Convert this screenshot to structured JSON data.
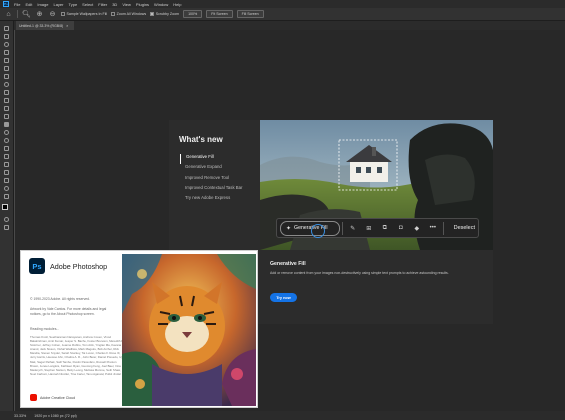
{
  "menubar": {
    "app_badge": "Ps",
    "items": [
      "File",
      "Edit",
      "Image",
      "Layer",
      "Type",
      "Select",
      "Filter",
      "3D",
      "View",
      "Plugins",
      "Window",
      "Help"
    ]
  },
  "options_bar": {
    "sample_all_layers": "Sample Wallpapers In Fill",
    "scrubby_zoom": "Scrubby Zoom",
    "zoom_value": "100%",
    "fit_screen": "Fit Screen",
    "fill_screen": "Fill Screen"
  },
  "document_tab": {
    "label": "Untitled-1 @ 33.3% (RGB/8)",
    "close_glyph": "×"
  },
  "status_bar": {
    "zoom": "33.33%",
    "doc_info": "1920 px x 1080 px (72 ppi)"
  },
  "whats_new": {
    "title": "What's new",
    "items": [
      "Generative Fill",
      "Generative Expand",
      "Improved Remove Tool",
      "Improved Contextual Task Bar",
      "Try new Adobe Express"
    ],
    "active_index": 0,
    "taskbar": {
      "generative_fill_label": "Generative Fill",
      "deselect_label": "Deselect",
      "icons": [
        "brush-icon",
        "transform-icon",
        "crop-icon",
        "mask-icon",
        "fill-icon",
        "more-icon"
      ]
    },
    "feature_title": "Generative Fill",
    "feature_description": "Add or remove content from your images non-destructively using simple text prompts to achieve astounding results.",
    "cta_label": "Try now"
  },
  "splash": {
    "logo": "Ps",
    "product_name": "Adobe Photoshop",
    "copyright": "© 1990-2023 Adobe. All rights reserved.",
    "credit": "Artwork by Vale Cantos. For more details and legal notices, go to the About Photoshop screen.",
    "starting": "Reading modules...",
    "names": "Thomas Knoll, Seetharaman Narayanan, Andrew Coven, Vinod Balakrishnan, Amit Kumar, Jesper S. Bache, Foster Brereton, Meredith P. Stotzner, Jeffrey Cohen, Jeanne Rubbo, Tom Attix, Yinglan Ma, Kavana Anand, Jack Sisson, Vishal Wadhwa, Mark Maguire, Bob Archer, Rick Mandia, Steven Snyder, Sarah Stuckey, Tai Luxon, Charles F. Rose III, Jerry Harris, Heewoo Ahn, Chaitra A. R., John Beier, Daniel Presedo, Ivy Mak, Sagar Pathak, Salil Tambe, Dustin Passofaro, Russell Preston Brown, Jenée Langlois, Kathleen Ryan, Guotong Feng, Joel Baer, Irina Maderych, Stephen Nielson, Betty Leong, Melissa Monroe, Seth Shaw, Noel Carboni, Hannah Nicollet, Tina Carter, Tanu Agarwal, Pulkit Jindal",
    "cc_label": "Adobe Creative Cloud"
  },
  "colors": {
    "accent": "#1473e6",
    "canvas_bg": "#282828",
    "panel_bg": "#2c2c2c",
    "ps_blue": "#31a8ff"
  }
}
